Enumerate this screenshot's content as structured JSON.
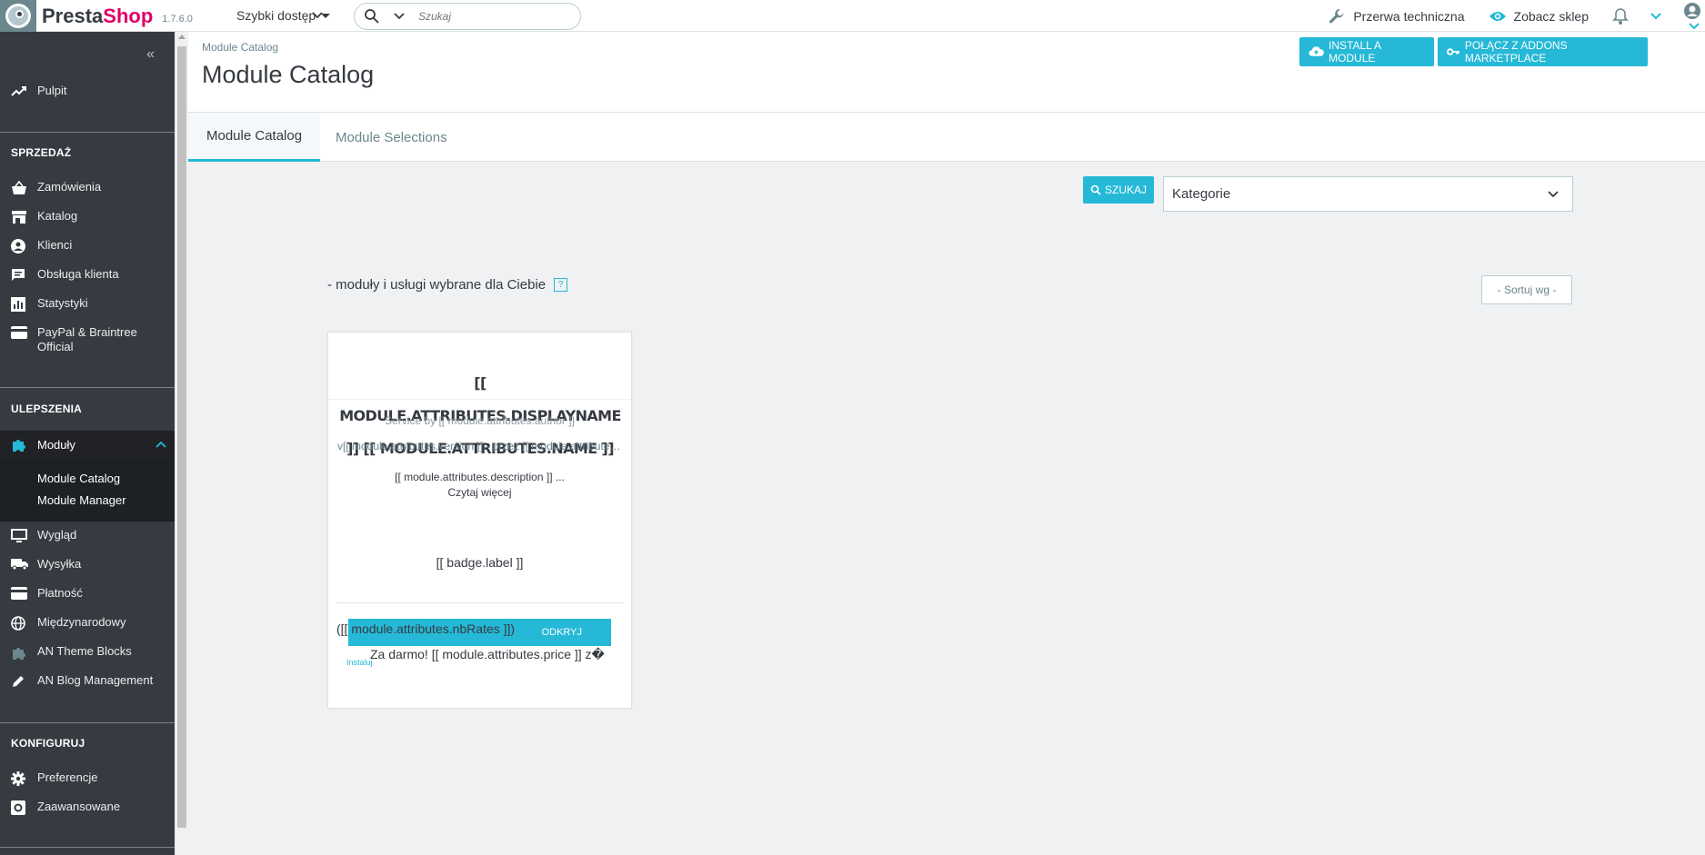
{
  "header": {
    "logo_text_presta": "Presta",
    "logo_text_shop": "Shop",
    "version": "1.7.6.0",
    "quick_access_label": "Szybki dostęp",
    "search_placeholder": "Szukaj",
    "maintenance_label": "Przerwa techniczna",
    "view_shop_label": "Zobacz sklep"
  },
  "sidebar": {
    "items_top": [
      {
        "label": "Pulpit",
        "icon": "trending-up-icon"
      }
    ],
    "sections": [
      {
        "title": "SPRZEDAŻ",
        "items": [
          {
            "label": "Zamówienia",
            "icon": "basket-icon"
          },
          {
            "label": "Katalog",
            "icon": "store-icon"
          },
          {
            "label": "Klienci",
            "icon": "account-circle-icon"
          },
          {
            "label": "Obsługa klienta",
            "icon": "chat-icon"
          },
          {
            "label": "Statystyki",
            "icon": "bar-chart-icon"
          },
          {
            "label": "PayPal & Braintree Official",
            "icon": "credit-card-icon"
          }
        ]
      },
      {
        "title": "ULEPSZENIA",
        "items": [
          {
            "label": "Moduły",
            "icon": "puzzle-icon",
            "active": true,
            "children": [
              "Module Catalog",
              "Module Manager"
            ]
          },
          {
            "label": "Wygląd",
            "icon": "monitor-icon"
          },
          {
            "label": "Wysyłka",
            "icon": "truck-icon"
          },
          {
            "label": "Płatność",
            "icon": "credit-card-icon"
          },
          {
            "label": "Międzynarodowy",
            "icon": "globe-icon"
          },
          {
            "label": "AN Theme Blocks",
            "icon": "puzzle-icon"
          },
          {
            "label": "AN Blog Management",
            "icon": "pencil-icon"
          }
        ]
      },
      {
        "title": "KONFIGURUJ",
        "items": [
          {
            "label": "Preferencje",
            "icon": "gear-icon"
          },
          {
            "label": "Zaawansowane",
            "icon": "settings-box-icon"
          }
        ]
      }
    ]
  },
  "page": {
    "breadcrumb": "Module Catalog",
    "title": "Module Catalog",
    "install_button": "INSTALL A MODULE",
    "addons_button": "POŁĄCZ Z ADDONS MARKETPLACE"
  },
  "tabs": [
    {
      "label": "Module Catalog",
      "active": true
    },
    {
      "label": "Module Selections",
      "active": false
    }
  ],
  "filters": {
    "search_button": "SZUKAJ",
    "category_selected": "Kategorie",
    "selection_text": "- moduły i usługi wybrane dla Ciebie",
    "help_label": "?",
    "sort_label": "- Sortuj wg -"
  },
  "module_card": {
    "title": "[[ MODULE.ATTRIBUTES.DISPLAYNAME ]] [[ MODULE.ATTRIBUTES.NAME ]]",
    "author": "Service by [[ module.attributes.author ]]",
    "version": "v[[ module.attributes.version ]] - przez [[ module.attributes.author ]]",
    "description": "[[ module.attributes.description ]] ...",
    "read_more": "Czytaj więcej",
    "badge": "[[ badge.label ]]",
    "rates": "([[ module.attributes.nbRates ]])",
    "discover_button": "ODKRYJ",
    "price": "Za darmo! [[ module.attributes.price ]] z�",
    "install_link": "Instaluj"
  },
  "colors": {
    "primary": "#25b9d7",
    "sidebar_bg": "#363a41",
    "brand_pink": "#df0067"
  }
}
